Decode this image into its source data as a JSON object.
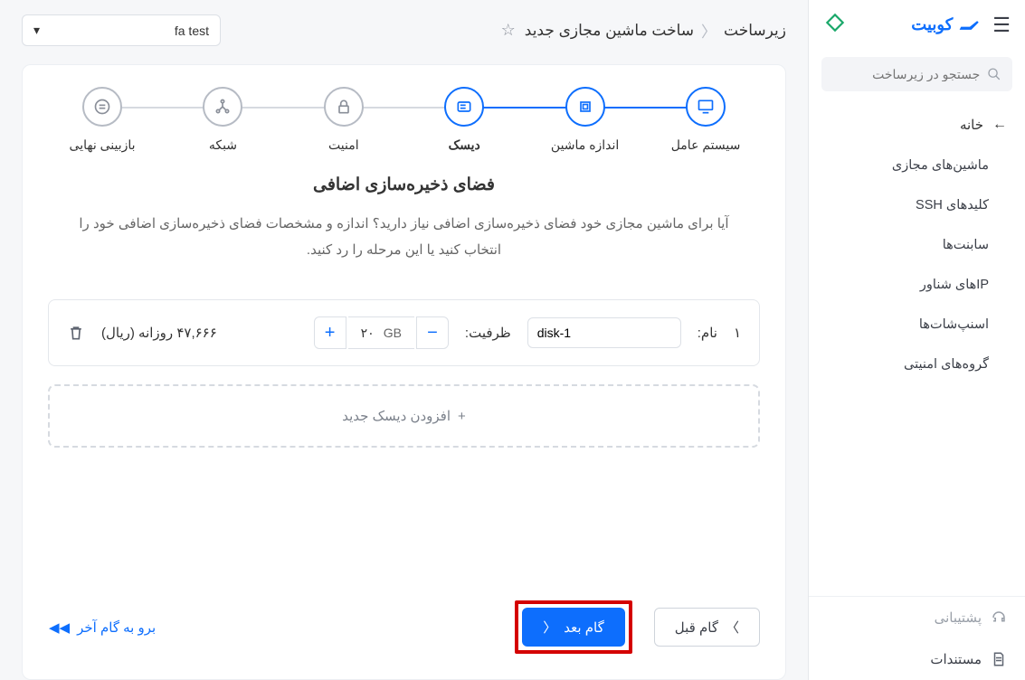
{
  "brand": {
    "name": "کوبیت"
  },
  "search": {
    "placeholder": "جستجو در زیرساخت"
  },
  "nav": {
    "home": "خانه",
    "items": [
      "ماشین‌های مجازی",
      "کلیدهای SSH",
      "سابنت‌ها",
      "IPهای شناور",
      "اسنپ‌شات‌ها",
      "گروه‌های امنیتی"
    ]
  },
  "footer_nav": {
    "support": "پشتیبانی",
    "docs": "مستندات"
  },
  "breadcrumb": {
    "root": "زیرساخت",
    "page": "ساخت ماشین مجازی جدید"
  },
  "project_select": {
    "value": "fa test"
  },
  "steps": [
    "سیستم عامل",
    "اندازه ماشین",
    "دیسک",
    "امنیت",
    "شبکه",
    "بازبینی نهایی"
  ],
  "heading": "فضای ذخیره‌سازی اضافی",
  "description": "آیا برای ماشین مجازی خود فضای ذخیره‌سازی اضافی نیاز دارید؟ اندازه و مشخصات فضای ذخیره‌سازی اضافی خود را انتخاب کنید یا این مرحله را رد کنید.",
  "disk": {
    "index": "۱",
    "name_label": "نام:",
    "name_value": "disk-1",
    "capacity_label": "ظرفیت:",
    "capacity_unit": "GB",
    "capacity_value": "۲۰",
    "price": "۴۷,۶۶۶ روزانه (ریال)"
  },
  "add_disk": "افزودن دیسک جدید",
  "buttons": {
    "prev": "گام قبل",
    "next": "گام بعد",
    "last": "برو به گام آخر"
  }
}
